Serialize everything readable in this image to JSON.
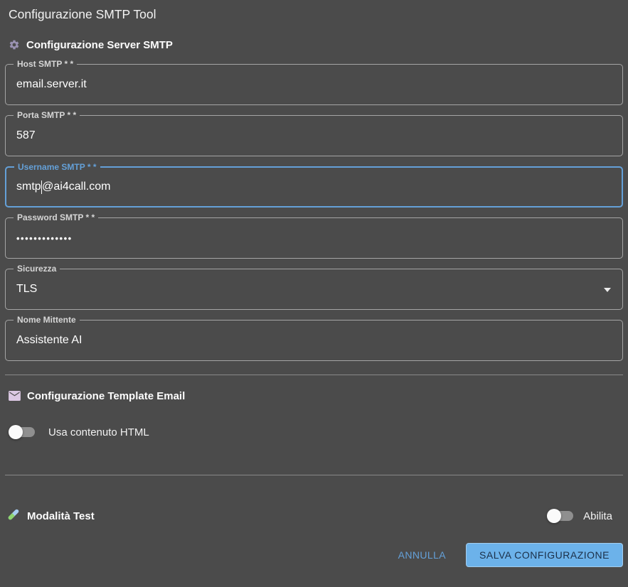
{
  "dialog": {
    "title": "Configurazione SMTP Tool"
  },
  "server_section": {
    "title": "Configurazione Server SMTP",
    "icon": "gear-icon",
    "fields": {
      "host": {
        "label": "Host SMTP * *",
        "value": "email.server.it"
      },
      "porta": {
        "label": "Porta SMTP * *",
        "value": "587"
      },
      "username": {
        "label": "Username SMTP * *",
        "value": "smtp@ai4call.com",
        "cursor_before": "smtp",
        "cursor_after": "@ai4call.com",
        "focused": true
      },
      "password": {
        "label": "Password SMTP * *",
        "masked_value": "•••••••••••••"
      },
      "sicurezza": {
        "label": "Sicurezza",
        "value": "TLS",
        "control": "select"
      },
      "nome_mittente": {
        "label": "Nome Mittente",
        "value": "Assistente AI"
      }
    }
  },
  "template_section": {
    "title": "Configurazione Template Email",
    "icon": "envelope-icon",
    "html_toggle": {
      "label": "Usa contenuto HTML",
      "state": "off"
    }
  },
  "test_section": {
    "title": "Modalità Test",
    "icon": "test-tube-icon",
    "toggle": {
      "label": "Abilita",
      "state": "off"
    }
  },
  "actions": {
    "cancel_label": "ANNULLA",
    "save_label": "SALVA CONFIGURAZIONE"
  },
  "colors": {
    "background": "#4b4b4b",
    "accent_blue": "#64a0d8",
    "save_button_bg": "#6cb2ea",
    "save_button_text": "#1c3048",
    "gear_icon": "#9a92b2",
    "envelope_icon": "#dcc9e4",
    "test_tube_green": "#8ed66f",
    "test_tube_blue": "#a8cdf0"
  }
}
